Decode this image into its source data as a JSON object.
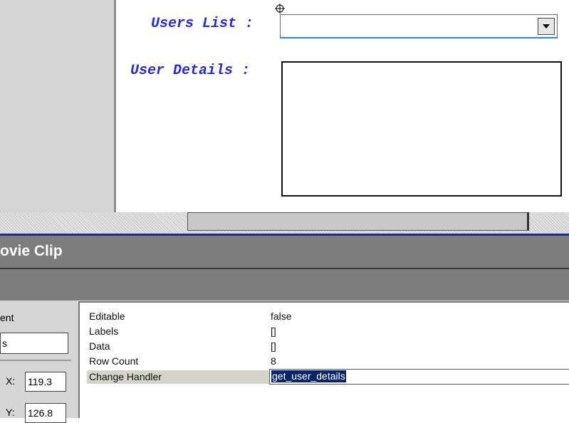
{
  "stage": {
    "users_list_label": "Users List :",
    "user_details_label": "User Details :",
    "combo_value": ""
  },
  "panel": {
    "title": "ovie Clip",
    "left_label": "ent",
    "instance_value": "s",
    "x_label": "X:",
    "x_value": "119.3",
    "y_label": "Y:",
    "y_value": "126.8"
  },
  "parameters": [
    {
      "name": "Editable",
      "value": "false"
    },
    {
      "name": "Labels",
      "value": "[]"
    },
    {
      "name": "Data",
      "value": "[]"
    },
    {
      "name": "Row Count",
      "value": "8"
    },
    {
      "name": "Change Handler",
      "value": "get_user_details"
    }
  ],
  "colors": {
    "stage_label": "#2a2ad6",
    "panel_title_bar": "#7d7d7d",
    "selection": "#0a246a"
  }
}
